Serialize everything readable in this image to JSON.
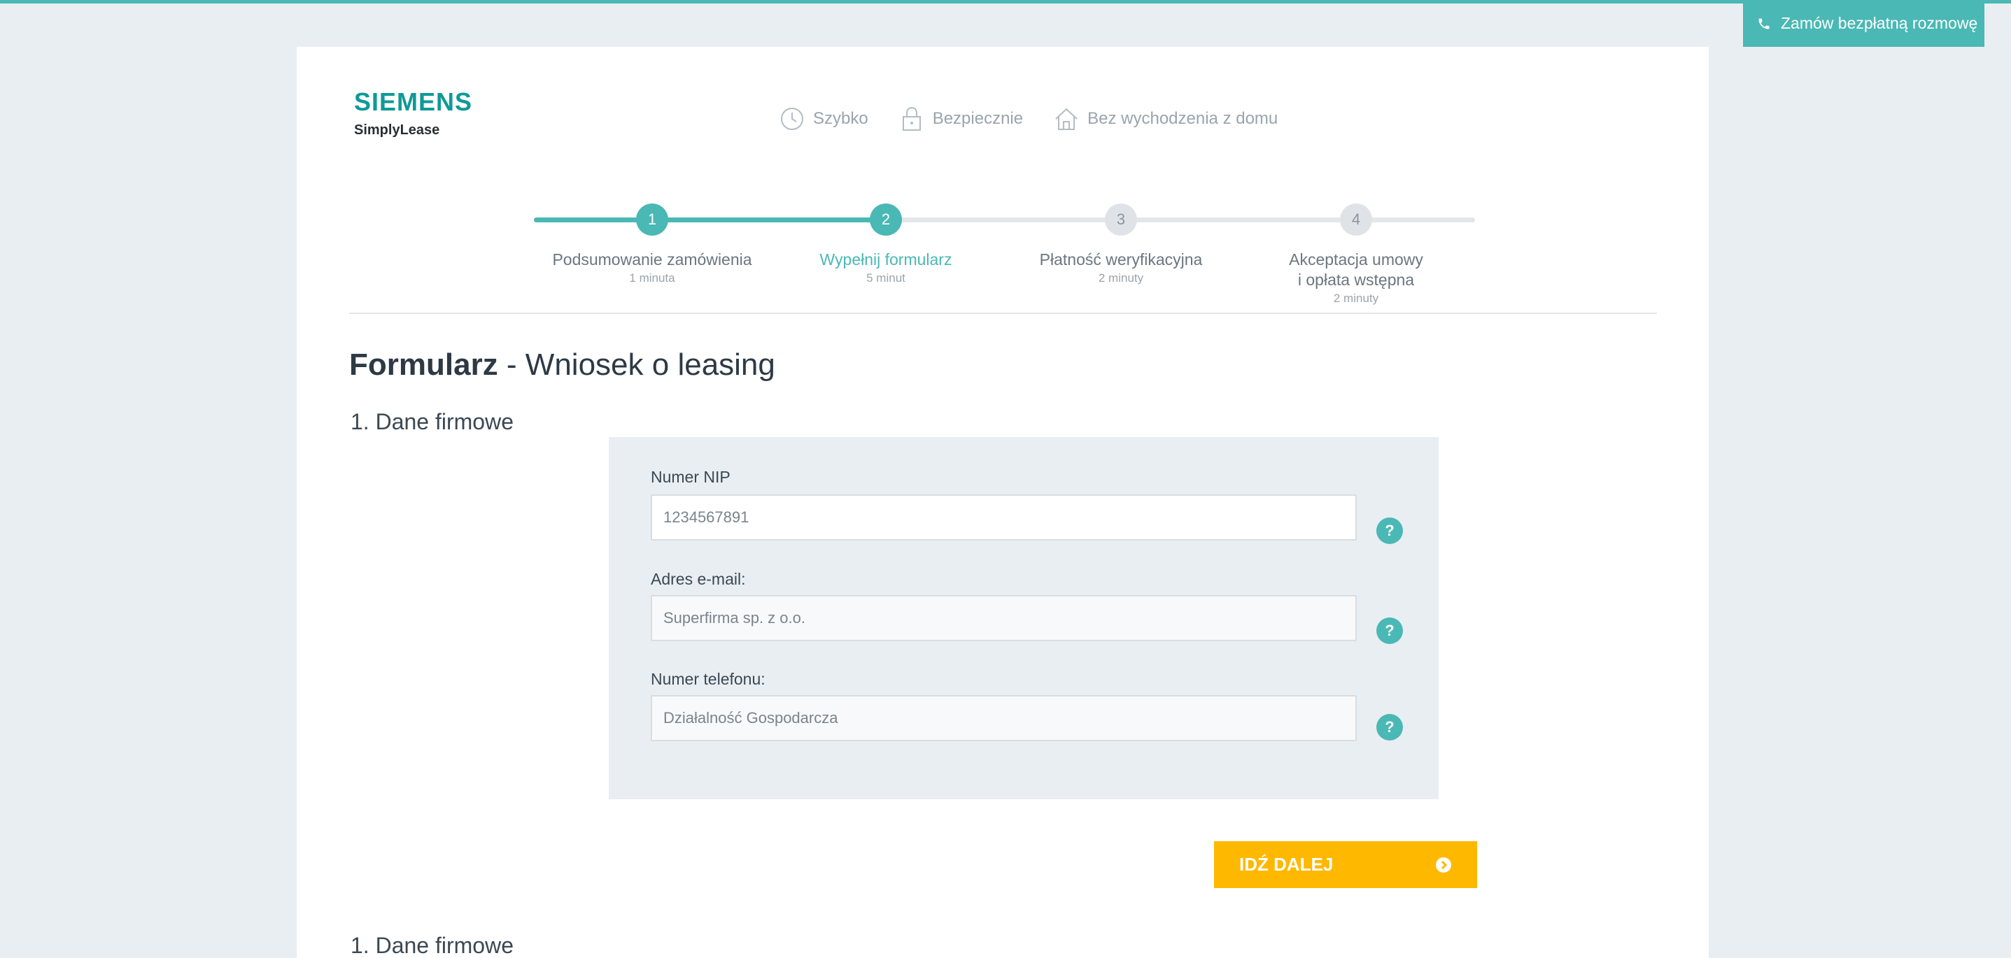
{
  "call_button": {
    "label": "Zamów bezpłatną rozmowę",
    "icon": "phone-icon"
  },
  "logo": {
    "brand": "SIEMENS",
    "product": "SimplyLease"
  },
  "features": [
    {
      "label": "Szybko",
      "icon": "clock-icon"
    },
    {
      "label": "Bezpiecznie",
      "icon": "lock-icon"
    },
    {
      "label": "Bez wychodzenia z domu",
      "icon": "home-icon"
    }
  ],
  "steps": [
    {
      "number": "1",
      "name": "Podsumowanie zamówienia",
      "time": "1 minuta",
      "state": "done"
    },
    {
      "number": "2",
      "name": "Wypełnij formularz",
      "time": "5 minut",
      "state": "current"
    },
    {
      "number": "3",
      "name": "Płatność weryfikacyjna",
      "time": "2 minuty",
      "state": "todo"
    },
    {
      "number": "4",
      "name_line1": "Akceptacja umowy",
      "name_line2": "i opłata wstępna",
      "time": "2 minuty",
      "state": "todo"
    }
  ],
  "page": {
    "title_bold": "Formularz",
    "title_rest": " - Wniosek o leasing",
    "section1": "1. Dane firmowe",
    "section2": "1. Dane firmowe"
  },
  "form": {
    "nip": {
      "label": "Numer NIP",
      "value": "1234567891"
    },
    "email": {
      "label": "Adres e-mail:",
      "placeholder": "Superfirma sp. z o.o."
    },
    "phone": {
      "label": "Numer telefonu:",
      "placeholder": "Działalność Gospodarcza"
    },
    "help_glyph": "?"
  },
  "next_button": {
    "label": "IDŹ DALEJ",
    "icon": "arrow-circle-right-icon"
  },
  "colors": {
    "accent": "#4ab8b4",
    "brand": "#0f9a97",
    "cta": "#ffb800",
    "background": "#e9eef2"
  }
}
